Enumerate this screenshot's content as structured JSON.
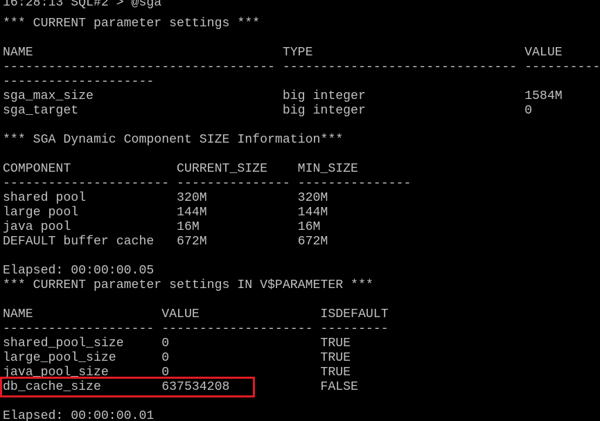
{
  "terminal": {
    "lines": [
      "16:28:13 SQL#2 > @sga",
      "*** CURRENT parameter settings ***",
      "",
      "NAME                                 TYPE                            VALUE",
      "------------------------------------ ------------------------------- ----------",
      "--------------------",
      "sga_max_size                         big integer                     1584M",
      "sga_target                           big integer                     0",
      "",
      "*** SGA Dynamic Component SIZE Information***",
      "",
      "COMPONENT              CURRENT_SIZE    MIN_SIZE",
      "---------------------- --------------- ---------------",
      "shared pool            320M            320M",
      "large pool             144M            144M",
      "java pool              16M             16M",
      "DEFAULT buffer cache   672M            672M",
      "",
      "Elapsed: 00:00:00.05",
      "*** CURRENT parameter settings IN V$PARAMETER ***",
      "",
      "NAME                 VALUE                ISDEFAULT",
      "-------------------- -------------------- ---------",
      "shared_pool_size     0                    TRUE",
      "large_pool_size      0                    TRUE",
      "java_pool_size       0                    TRUE",
      "db_cache_size        637534208            FALSE",
      "",
      "Elapsed: 00:00:00.01"
    ]
  },
  "highlight": {
    "color": "#e01b24",
    "target_line": "db_cache_size        637534208"
  },
  "colors": {
    "background": "#000000",
    "text": "#c0c0c0"
  }
}
